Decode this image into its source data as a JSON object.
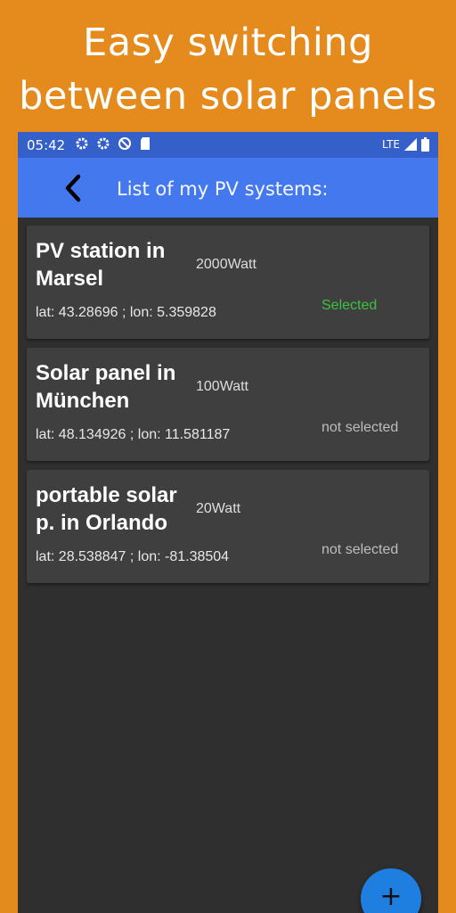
{
  "promo": {
    "line1": "Easy switching",
    "line2": "between solar panels"
  },
  "status_bar": {
    "time": "05:42",
    "network": "LTE",
    "icons": [
      "gear-icon",
      "gear-icon",
      "at-sign-icon",
      "sd-card-icon",
      "signal-icon",
      "battery-icon"
    ]
  },
  "app_bar": {
    "title": "List of my PV systems:",
    "back_icon": "chevron-left-icon"
  },
  "systems": [
    {
      "name": "PV station in Marsel",
      "power": "2000Watt",
      "coords": "lat: 43.28696 ; lon: 5.359828",
      "status": "Selected",
      "selected": true
    },
    {
      "name": "Solar panel in München",
      "power": "100Watt",
      "coords": "lat: 48.134926 ; lon: 11.581187",
      "status": "not selected",
      "selected": false
    },
    {
      "name": "portable solar p. in Orlando",
      "power": "20Watt",
      "coords": "lat: 28.538847 ; lon: -81.38504",
      "status": "not selected",
      "selected": false
    }
  ],
  "fab": {
    "label": "+"
  },
  "colors": {
    "background": "#E58A1D",
    "app_bar": "#4478EE",
    "status_bar": "#3560c9",
    "card": "#3f3f3f",
    "selected": "#3ec13e",
    "fab": "#1E7FE0"
  }
}
